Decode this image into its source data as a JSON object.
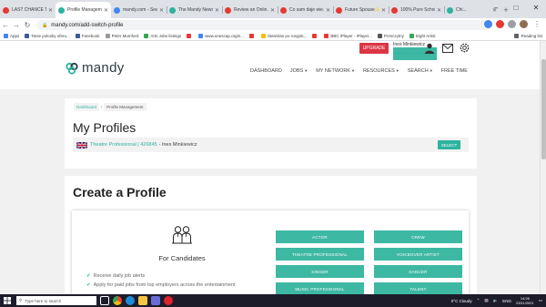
{
  "browser": {
    "tabs": [
      {
        "title": "LAST CHANCE T...",
        "color": "#e53935",
        "active": false
      },
      {
        "title": "Profile Managem...",
        "color": "#2db39e",
        "active": true
      },
      {
        "title": "mandy.com - Sea...",
        "color": "#4285f4",
        "active": false
      },
      {
        "title": "The Mandy News...",
        "color": "#2db39e",
        "active": false
      },
      {
        "title": "Review an Onlin...",
        "color": "#e53935",
        "active": false
      },
      {
        "title": "Co sam daje wie...",
        "color": "#e53935",
        "active": false
      },
      {
        "title": "Future Spouse✨",
        "color": "#e53935",
        "active": false
      },
      {
        "title": "100% Pure Schol...",
        "color": "#e53935",
        "active": false
      },
      {
        "title": "Chi...",
        "color": "#2db39e",
        "active": false
      }
    ],
    "new_tab": "+",
    "window_controls": [
      "–",
      "□",
      "✕"
    ],
    "url": "mandy.com/add-switch-profile",
    "bookmarks": [
      {
        "label": "Apps",
        "color": "#4285f4"
      },
      {
        "label": "Tanie pokoiky oferu...",
        "color": "#3b5998"
      },
      {
        "label": "Facebook",
        "color": "#3b5998"
      },
      {
        "label": "Peter Mumford",
        "color": "#999999"
      },
      {
        "label": "Arts Jobs listings",
        "color": "#34a853"
      },
      {
        "label": "",
        "color": "#e53935"
      },
      {
        "label": "www.unescap.org/s...",
        "color": "#4285f4"
      },
      {
        "label": "",
        "color": "#e53935"
      },
      {
        "label": "Stanislas po rosyjsk...",
        "color": "#fbbc05"
      },
      {
        "label": "",
        "color": "#e53935"
      },
      {
        "label": "BBC iPlayer - iPlayer...",
        "color": "#e53935"
      },
      {
        "label": "Przeczytny",
        "color": "#555555"
      },
      {
        "label": "Eight Artist",
        "color": "#34a853"
      }
    ],
    "reading_list": "Reading list"
  },
  "header": {
    "upgrade_label": "UPGRADE",
    "user_name": "Ines Minkiewicz",
    "user_role": "THEATRE PROFESSIONAL",
    "logo_text": "mandy",
    "nav": [
      {
        "label": "DASHBOARD",
        "caret": false
      },
      {
        "label": "JOBS",
        "caret": true
      },
      {
        "label": "MY NETWORK",
        "caret": true
      },
      {
        "label": "RESOURCES",
        "caret": true
      },
      {
        "label": "SEARCH",
        "caret": true
      },
      {
        "label": "FREE TIME",
        "caret": false
      }
    ],
    "accent_color": "#2db39e"
  },
  "profiles": {
    "breadcrumb": [
      "Dashboard",
      "Profile Management"
    ],
    "title": "My Profiles",
    "row": {
      "link_text": "Theatre Professional | 426845",
      "name_text": "- Ines Minkiewicz",
      "select_label": "SELECT"
    }
  },
  "create": {
    "title": "Create a Profile",
    "candidates_title": "For Candidates",
    "benefits": [
      "Receive daily job alerts",
      "Apply for paid jobs from top employers across the entertainment"
    ],
    "roles": [
      "ACTOR",
      "CREW",
      "THEATRE PROFESSIONAL",
      "VOICEOVER ARTIST",
      "SINGER",
      "DANCER",
      "MUSIC PROFESSIONAL",
      "TALENT"
    ]
  },
  "taskbar": {
    "search_placeholder": "Type here to search",
    "weather": "0°C  Cloudy",
    "language": "ENG",
    "time": "14:26",
    "date": "23/11/2021"
  }
}
